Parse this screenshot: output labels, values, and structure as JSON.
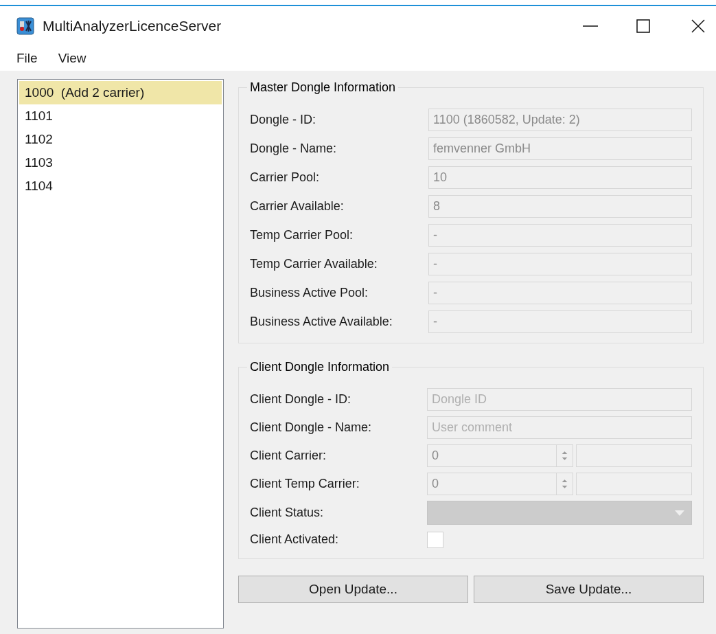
{
  "window": {
    "title": "MultiAnalyzerLicenceServer"
  },
  "menu": [
    "File",
    "View"
  ],
  "dongle_list": [
    {
      "label": "1000  (Add 2 carrier)",
      "selected": true
    },
    {
      "label": "1101",
      "selected": false
    },
    {
      "label": "1102",
      "selected": false
    },
    {
      "label": "1103",
      "selected": false
    },
    {
      "label": "1104",
      "selected": false
    }
  ],
  "master": {
    "title": "Master Dongle Information",
    "fields": [
      {
        "label": "Dongle - ID:",
        "value": "1100 (1860582, Update: 2)"
      },
      {
        "label": "Dongle - Name:",
        "value": "femvenner GmbH"
      },
      {
        "label": "Carrier Pool:",
        "value": "10"
      },
      {
        "label": "Carrier Available:",
        "value": "8"
      },
      {
        "label": "Temp Carrier Pool:",
        "value": "-"
      },
      {
        "label": "Temp Carrier Available:",
        "value": "-"
      },
      {
        "label": "Business Active Pool:",
        "value": "-"
      },
      {
        "label": "Business Active Available:",
        "value": "-"
      }
    ]
  },
  "client": {
    "title": "Client Dongle Information",
    "fields": [
      {
        "kind": "text",
        "label": "Client Dongle - ID:",
        "placeholder": "Dongle ID"
      },
      {
        "kind": "text",
        "label": "Client Dongle - Name:",
        "placeholder": "User comment"
      },
      {
        "kind": "spin",
        "label": "Client Carrier:",
        "value": "0"
      },
      {
        "kind": "spin",
        "label": "Client Temp Carrier:",
        "value": "0"
      },
      {
        "kind": "combo",
        "label": "Client Status:"
      },
      {
        "kind": "checkbox",
        "label": "Client Activated:",
        "checked": false
      }
    ]
  },
  "buttons": [
    "Open Update...",
    "Save Update..."
  ]
}
